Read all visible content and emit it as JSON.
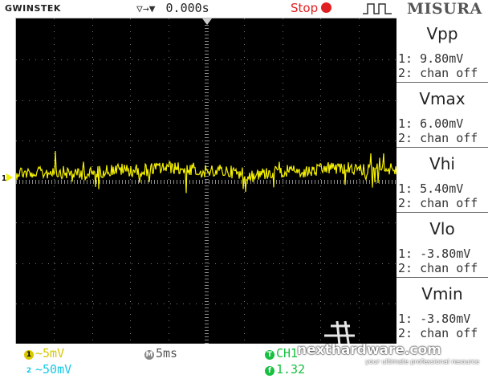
{
  "header": {
    "brand": "GWINSTEK",
    "timebase_value": "0.000s",
    "run_state": "Stop",
    "panel_title": "MISURA"
  },
  "colors": {
    "trace": "#f4f000",
    "stop": "#e02020",
    "ch2": "#18c8e8",
    "trigger": "#18c040"
  },
  "measurements": [
    {
      "name": "Vpp",
      "ch1": "1: 9.80mV",
      "ch2": "2: chan off"
    },
    {
      "name": "Vmax",
      "ch1": "1: 6.00mV",
      "ch2": "2: chan off"
    },
    {
      "name": "Vhi",
      "ch1": "1: 5.40mV",
      "ch2": "2: chan off"
    },
    {
      "name": "Vlo",
      "ch1": "1: -3.80mV",
      "ch2": "2: chan off"
    },
    {
      "name": "Vmin",
      "ch1": "1: -3.80mV",
      "ch2": "2: chan off"
    }
  ],
  "channel_marker": "1",
  "footer": {
    "ch1_badge": "1",
    "ch1_scale": "~5mV",
    "ch2_badge": "2",
    "ch2_scale": "~50mV",
    "time_badge": "M",
    "time_scale": "5ms",
    "trig_badge": "T",
    "trig_source": "CH1",
    "freq_badge": "f",
    "freq_value": "1.32"
  },
  "watermark": {
    "site": "nexthardware.com",
    "tagline": "your ultimate professional resource"
  }
}
